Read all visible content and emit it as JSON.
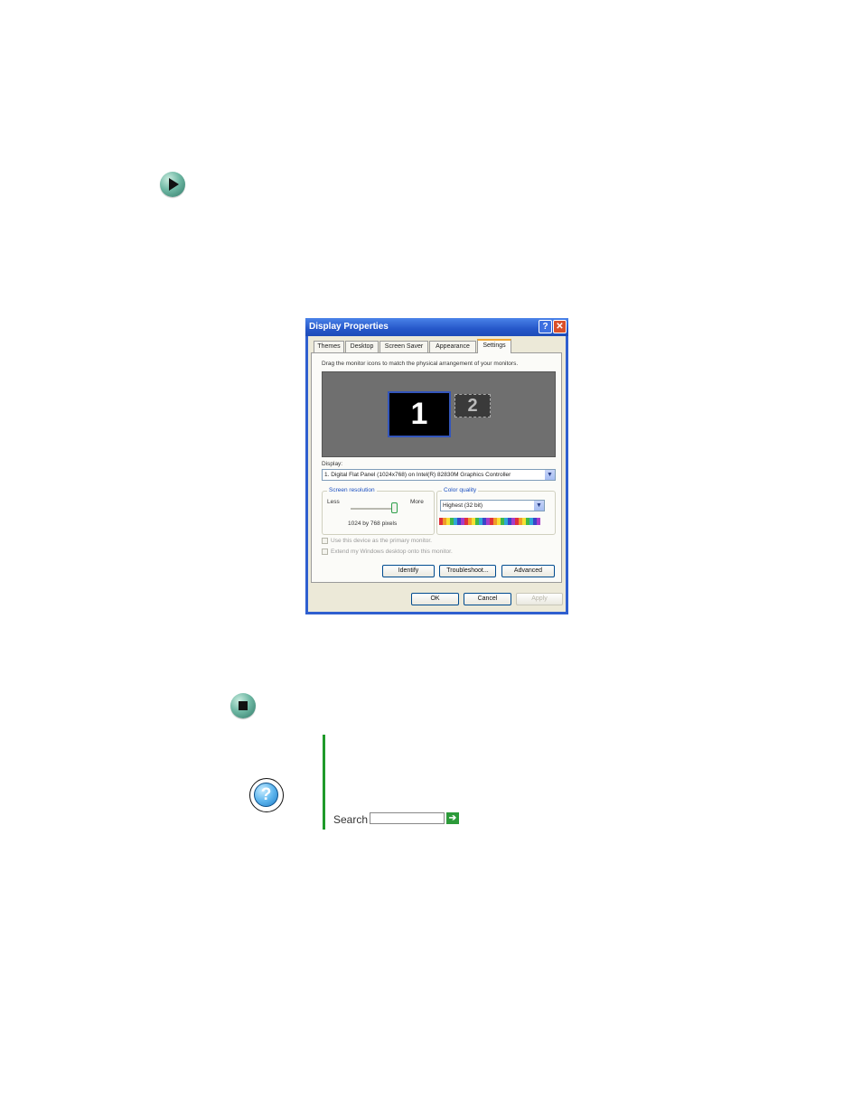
{
  "dialog": {
    "title": "Display Properties",
    "help_button": "?",
    "close_button": "✕",
    "tabs": [
      "Themes",
      "Desktop",
      "Screen Saver",
      "Appearance",
      "Settings"
    ],
    "instruction": "Drag the monitor icons to match the physical arrangement of your monitors.",
    "monitor_1": "1",
    "monitor_2": "2",
    "display_label": "Display:",
    "display_value": "1. Digital Flat Panel (1024x768) on Intel(R) 82830M Graphics Controller",
    "screen_resolution": {
      "label": "Screen resolution",
      "less": "Less",
      "more": "More",
      "value": "1024 by 768 pixels"
    },
    "color_quality": {
      "label": "Color quality",
      "value": "Highest (32 bit)"
    },
    "checkbox_primary": "Use this device as the primary monitor.",
    "checkbox_extend": "Extend my Windows desktop onto this monitor.",
    "buttons": {
      "identify": "Identify",
      "troubleshoot": "Troubleshoot...",
      "advanced": "Advanced",
      "ok": "OK",
      "cancel": "Cancel",
      "apply": "Apply"
    }
  },
  "help": {
    "search_label": "Search",
    "search_value": ""
  },
  "icons": {
    "procedure_start": "play-arrow-icon",
    "procedure_end": "stop-square-icon",
    "help": "question-mark-icon",
    "search_go": "arrow-right-icon"
  },
  "colors": {
    "help_rule": "#1f9a2a",
    "title_bar": "#2557c9"
  }
}
